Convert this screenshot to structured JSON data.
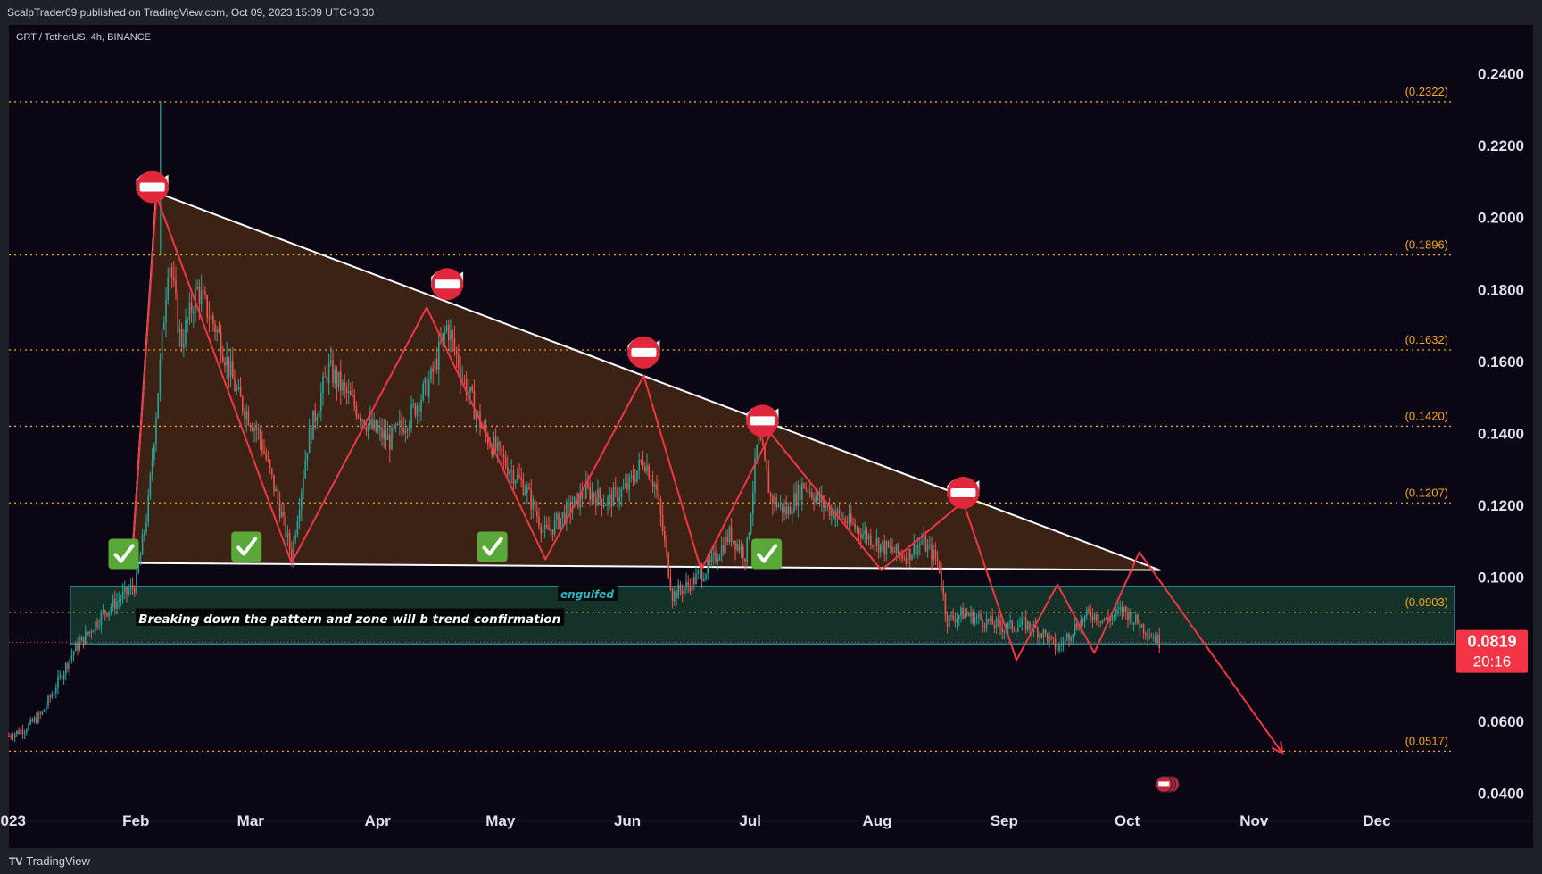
{
  "header": {
    "publisher_line": "ScalpTrader69 published on TradingView.com, Oct 09, 2023 15:09 UTC+3:30"
  },
  "footer": {
    "brand": "TradingView",
    "brand_icon": "tradingview-logo-icon"
  },
  "colors": {
    "background": "#0a0614",
    "bull": "#26a69a",
    "bear": "#ef5350",
    "fib_line": "#f5a623",
    "pattern_fill": "#4a2a14",
    "pattern_line": "#ffffff",
    "zigzag": "#f23645",
    "zone_fill": "#163a2e",
    "zone_border": "#2bb8c8",
    "price_tag": "#f23645"
  },
  "chart_data": {
    "type": "candlestick",
    "title": "GRT / TetherUS, 4h, BINANCE",
    "x_axis": {
      "type": "time",
      "tick_labels": [
        "2023",
        "Feb",
        "Mar",
        "Apr",
        "May",
        "Jun",
        "Jul",
        "Aug",
        "Sep",
        "Oct",
        "Nov",
        "Dec"
      ],
      "tick_dates": [
        "2023-01-01",
        "2023-02-01",
        "2023-03-01",
        "2023-04-01",
        "2023-05-01",
        "2023-06-01",
        "2023-07-01",
        "2023-08-01",
        "2023-09-01",
        "2023-10-01",
        "2023-11-01",
        "2023-12-01"
      ]
    },
    "y_axis": {
      "position": "right",
      "range": [
        0.034,
        0.26
      ],
      "tick_values": [
        0.04,
        0.06,
        0.08,
        0.1,
        0.12,
        0.14,
        0.16,
        0.18,
        0.2,
        0.22,
        0.24
      ],
      "tick_labels": [
        "0.0400",
        "0.0600",
        "0.0800",
        "0.1000",
        "0.1200",
        "0.1400",
        "0.1600",
        "0.1800",
        "0.2000",
        "0.2200",
        "0.2400"
      ]
    },
    "current_price": {
      "value": 0.0819,
      "label": "0.0819",
      "countdown": "20:16"
    },
    "price_path": [
      {
        "date": "2023-01-01",
        "price": 0.056
      },
      {
        "date": "2023-01-05",
        "price": 0.058
      },
      {
        "date": "2023-01-09",
        "price": 0.062
      },
      {
        "date": "2023-01-13",
        "price": 0.071
      },
      {
        "date": "2023-01-17",
        "price": 0.08
      },
      {
        "date": "2023-01-20",
        "price": 0.084
      },
      {
        "date": "2023-01-24",
        "price": 0.09
      },
      {
        "date": "2023-01-28",
        "price": 0.094
      },
      {
        "date": "2023-02-01",
        "price": 0.098
      },
      {
        "date": "2023-02-04",
        "price": 0.12
      },
      {
        "date": "2023-02-07",
        "price": 0.16
      },
      {
        "date": "2023-02-09",
        "price": 0.19
      },
      {
        "date": "2023-02-12",
        "price": 0.165
      },
      {
        "date": "2023-02-16",
        "price": 0.18
      },
      {
        "date": "2023-02-21",
        "price": 0.168
      },
      {
        "date": "2023-02-26",
        "price": 0.15
      },
      {
        "date": "2023-03-03",
        "price": 0.14
      },
      {
        "date": "2023-03-08",
        "price": 0.12
      },
      {
        "date": "2023-03-11",
        "price": 0.106
      },
      {
        "date": "2023-03-15",
        "price": 0.138
      },
      {
        "date": "2023-03-20",
        "price": 0.158
      },
      {
        "date": "2023-03-25",
        "price": 0.15
      },
      {
        "date": "2023-03-30",
        "price": 0.142
      },
      {
        "date": "2023-04-04",
        "price": 0.138
      },
      {
        "date": "2023-04-09",
        "price": 0.145
      },
      {
        "date": "2023-04-14",
        "price": 0.155
      },
      {
        "date": "2023-04-18",
        "price": 0.17
      },
      {
        "date": "2023-04-22",
        "price": 0.155
      },
      {
        "date": "2023-04-27",
        "price": 0.14
      },
      {
        "date": "2023-05-02",
        "price": 0.132
      },
      {
        "date": "2023-05-07",
        "price": 0.125
      },
      {
        "date": "2023-05-12",
        "price": 0.112
      },
      {
        "date": "2023-05-17",
        "price": 0.118
      },
      {
        "date": "2023-05-22",
        "price": 0.124
      },
      {
        "date": "2023-05-27",
        "price": 0.121
      },
      {
        "date": "2023-06-01",
        "price": 0.125
      },
      {
        "date": "2023-06-05",
        "price": 0.133
      },
      {
        "date": "2023-06-08",
        "price": 0.125
      },
      {
        "date": "2023-06-10",
        "price": 0.11
      },
      {
        "date": "2023-06-12",
        "price": 0.095
      },
      {
        "date": "2023-06-16",
        "price": 0.098
      },
      {
        "date": "2023-06-21",
        "price": 0.103
      },
      {
        "date": "2023-06-26",
        "price": 0.112
      },
      {
        "date": "2023-06-30",
        "price": 0.106
      },
      {
        "date": "2023-07-03",
        "price": 0.14
      },
      {
        "date": "2023-07-06",
        "price": 0.122
      },
      {
        "date": "2023-07-10",
        "price": 0.118
      },
      {
        "date": "2023-07-14",
        "price": 0.126
      },
      {
        "date": "2023-07-19",
        "price": 0.12
      },
      {
        "date": "2023-07-24",
        "price": 0.116
      },
      {
        "date": "2023-07-29",
        "price": 0.112
      },
      {
        "date": "2023-08-03",
        "price": 0.108
      },
      {
        "date": "2023-08-08",
        "price": 0.106
      },
      {
        "date": "2023-08-12",
        "price": 0.11
      },
      {
        "date": "2023-08-16",
        "price": 0.104
      },
      {
        "date": "2023-08-18",
        "price": 0.088
      },
      {
        "date": "2023-08-22",
        "price": 0.09
      },
      {
        "date": "2023-08-27",
        "price": 0.088
      },
      {
        "date": "2023-09-01",
        "price": 0.086
      },
      {
        "date": "2023-09-06",
        "price": 0.087
      },
      {
        "date": "2023-09-11",
        "price": 0.084
      },
      {
        "date": "2023-09-14",
        "price": 0.08
      },
      {
        "date": "2023-09-18",
        "price": 0.086
      },
      {
        "date": "2023-09-22",
        "price": 0.09
      },
      {
        "date": "2023-09-26",
        "price": 0.088
      },
      {
        "date": "2023-09-30",
        "price": 0.091
      },
      {
        "date": "2023-10-04",
        "price": 0.087
      },
      {
        "date": "2023-10-09",
        "price": 0.0819
      }
    ],
    "pattern_triangle": [
      {
        "date": "2023-01-31",
        "price": 0.104
      },
      {
        "date": "2023-02-06",
        "price": 0.207
      },
      {
        "date": "2023-10-09",
        "price": 0.102
      }
    ],
    "zigzag": [
      {
        "date": "2023-01-31",
        "price": 0.104
      },
      {
        "date": "2023-02-06",
        "price": 0.206
      },
      {
        "date": "2023-03-11",
        "price": 0.104
      },
      {
        "date": "2023-04-13",
        "price": 0.175
      },
      {
        "date": "2023-04-18",
        "price": 0.163
      },
      {
        "date": "2023-05-12",
        "price": 0.105
      },
      {
        "date": "2023-06-05",
        "price": 0.156
      },
      {
        "date": "2023-06-19",
        "price": 0.102
      },
      {
        "date": "2023-07-06",
        "price": 0.14
      },
      {
        "date": "2023-08-02",
        "price": 0.102
      },
      {
        "date": "2023-08-22",
        "price": 0.121
      },
      {
        "date": "2023-09-04",
        "price": 0.077
      },
      {
        "date": "2023-09-14",
        "price": 0.098
      },
      {
        "date": "2023-09-23",
        "price": 0.079
      },
      {
        "date": "2023-10-04",
        "price": 0.107
      },
      {
        "date": "2023-11-08",
        "price": 0.051
      }
    ],
    "fib_levels": [
      {
        "value": 0.2322,
        "label": "(0.2322)"
      },
      {
        "value": 0.1896,
        "label": "(0.1896)"
      },
      {
        "value": 0.1632,
        "label": "(0.1632)"
      },
      {
        "value": 0.142,
        "label": "(0.1420)"
      },
      {
        "value": 0.1207,
        "label": "(0.1207)"
      },
      {
        "value": 0.0903,
        "label": "(0.0903)"
      },
      {
        "value": 0.0517,
        "label": "(0.0517)"
      }
    ],
    "zone": {
      "top": 0.0975,
      "bottom": 0.0815,
      "from_date": "2023-01-16"
    },
    "resistance_marks": [
      {
        "date": "2023-02-05",
        "price": 0.2085
      },
      {
        "date": "2023-04-18",
        "price": 0.1815
      },
      {
        "date": "2023-06-05",
        "price": 0.1625
      },
      {
        "date": "2023-07-04",
        "price": 0.1435
      },
      {
        "date": "2023-08-22",
        "price": 0.1235
      }
    ],
    "support_checks": [
      {
        "date": "2023-01-29",
        "price": 0.1065
      },
      {
        "date": "2023-02-28",
        "price": 0.1085
      },
      {
        "date": "2023-04-29",
        "price": 0.1085
      },
      {
        "date": "2023-07-05",
        "price": 0.1065
      }
    ],
    "annotations": [
      {
        "text": "engulfed",
        "date": "2023-05-15",
        "price": 0.0955,
        "color": "#2bb8c8"
      },
      {
        "text": "Breaking down the pattern and zone will b trend confirmation",
        "date": "2023-02-01",
        "price": 0.0885,
        "color": "#ffffff"
      }
    ],
    "events": [
      {
        "date": "2023-10-10",
        "price": 0.0425,
        "icon": "us-flag-icon"
      }
    ]
  }
}
